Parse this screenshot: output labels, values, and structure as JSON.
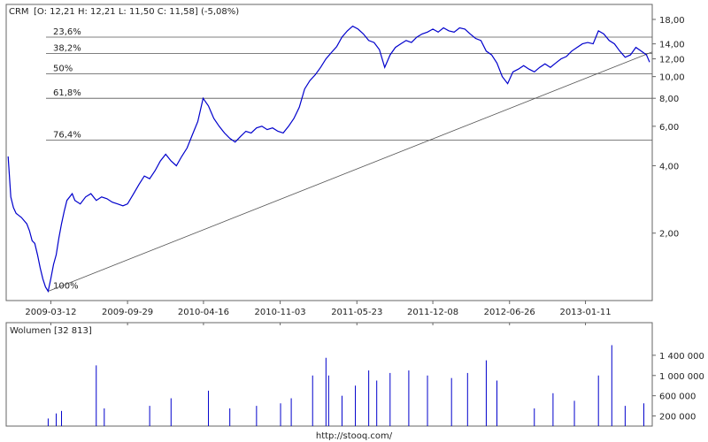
{
  "header": {
    "ticker": "CRM",
    "ohlc": "[O: 12,21  H: 12,21  L: 11,50  C: 11,58] (-5,08%)"
  },
  "volume_panel": {
    "title": "Wolumen [32 813]"
  },
  "footer": {
    "url": "http://stooq.com/"
  },
  "colors": {
    "price_line": "#0000cc",
    "volume_bars": "#0000cc",
    "fib_lines": "#555555",
    "trend_line": "#555555",
    "frame": "#666666",
    "tick_grid": "#cccccc"
  },
  "chart_data": [
    {
      "type": "line",
      "title": "",
      "scale": "log",
      "ylim": [
        1.0,
        21.0
      ],
      "price_ticks": [
        "18,00",
        "14,00",
        "12,00",
        "10,00",
        "8,00",
        "6,00",
        "4,00",
        "2,00"
      ],
      "x_tick_labels": [
        "2009-03-12",
        "2009-09-29",
        "2010-04-16",
        "2010-11-03",
        "2011-05-23",
        "2011-12-08",
        "2012-06-26",
        "2013-01-11"
      ],
      "fib_levels": [
        {
          "label": "23,6%",
          "price": 15.0
        },
        {
          "label": "38,2%",
          "price": 12.7
        },
        {
          "label": "50%",
          "price": 10.3
        },
        {
          "label": "61,8%",
          "price": 8.0
        },
        {
          "label": "76,4%",
          "price": 5.2
        },
        {
          "label": "100%",
          "price": 1.1
        }
      ],
      "trend_line": {
        "from": [
          "2009-03-05",
          1.1
        ],
        "to": [
          "2013-06-28",
          12.2
        ]
      },
      "series": [
        {
          "name": "",
          "points": [
            [
              "2008-11-20",
              4.4
            ],
            [
              "2008-11-27",
              2.9
            ],
            [
              "2008-12-04",
              2.6
            ],
            [
              "2008-12-11",
              2.45
            ],
            [
              "2008-12-18",
              2.4
            ],
            [
              "2008-12-25",
              2.35
            ],
            [
              "2009-01-08",
              2.2
            ],
            [
              "2009-01-15",
              2.05
            ],
            [
              "2009-01-22",
              1.85
            ],
            [
              "2009-01-29",
              1.8
            ],
            [
              "2009-02-05",
              1.6
            ],
            [
              "2009-02-12",
              1.4
            ],
            [
              "2009-02-19",
              1.25
            ],
            [
              "2009-02-26",
              1.15
            ],
            [
              "2009-03-05",
              1.1
            ],
            [
              "2009-03-12",
              1.25
            ],
            [
              "2009-03-19",
              1.45
            ],
            [
              "2009-03-26",
              1.6
            ],
            [
              "2009-04-02",
              1.9
            ],
            [
              "2009-04-09",
              2.2
            ],
            [
              "2009-04-16",
              2.5
            ],
            [
              "2009-04-23",
              2.8
            ],
            [
              "2009-05-07",
              3.0
            ],
            [
              "2009-05-14",
              2.8
            ],
            [
              "2009-05-28",
              2.7
            ],
            [
              "2009-06-11",
              2.9
            ],
            [
              "2009-06-25",
              3.0
            ],
            [
              "2009-07-09",
              2.8
            ],
            [
              "2009-07-23",
              2.9
            ],
            [
              "2009-08-06",
              2.85
            ],
            [
              "2009-08-20",
              2.75
            ],
            [
              "2009-09-03",
              2.7
            ],
            [
              "2009-09-17",
              2.65
            ],
            [
              "2009-09-29",
              2.7
            ],
            [
              "2009-10-15",
              3.0
            ],
            [
              "2009-10-29",
              3.3
            ],
            [
              "2009-11-12",
              3.6
            ],
            [
              "2009-11-26",
              3.5
            ],
            [
              "2009-12-10",
              3.8
            ],
            [
              "2009-12-24",
              4.2
            ],
            [
              "2010-01-07",
              4.5
            ],
            [
              "2010-01-21",
              4.2
            ],
            [
              "2010-02-04",
              4.0
            ],
            [
              "2010-02-18",
              4.4
            ],
            [
              "2010-03-04",
              4.8
            ],
            [
              "2010-03-18",
              5.5
            ],
            [
              "2010-04-01",
              6.3
            ],
            [
              "2010-04-15",
              8.0
            ],
            [
              "2010-04-29",
              7.4
            ],
            [
              "2010-05-13",
              6.5
            ],
            [
              "2010-05-27",
              6.0
            ],
            [
              "2010-06-10",
              5.6
            ],
            [
              "2010-06-24",
              5.3
            ],
            [
              "2010-07-08",
              5.1
            ],
            [
              "2010-07-22",
              5.4
            ],
            [
              "2010-08-05",
              5.7
            ],
            [
              "2010-08-19",
              5.6
            ],
            [
              "2010-09-02",
              5.9
            ],
            [
              "2010-09-16",
              6.0
            ],
            [
              "2010-09-30",
              5.8
            ],
            [
              "2010-10-14",
              5.9
            ],
            [
              "2010-10-28",
              5.7
            ],
            [
              "2010-11-11",
              5.6
            ],
            [
              "2010-11-25",
              6.0
            ],
            [
              "2010-12-09",
              6.5
            ],
            [
              "2010-12-23",
              7.3
            ],
            [
              "2011-01-06",
              8.8
            ],
            [
              "2011-01-20",
              9.6
            ],
            [
              "2011-02-03",
              10.2
            ],
            [
              "2011-02-17",
              11.0
            ],
            [
              "2011-03-03",
              12.0
            ],
            [
              "2011-03-17",
              12.8
            ],
            [
              "2011-03-31",
              13.6
            ],
            [
              "2011-04-14",
              15.0
            ],
            [
              "2011-04-28",
              16.0
            ],
            [
              "2011-05-12",
              16.8
            ],
            [
              "2011-05-26",
              16.3
            ],
            [
              "2011-06-09",
              15.5
            ],
            [
              "2011-06-23",
              14.5
            ],
            [
              "2011-07-07",
              14.2
            ],
            [
              "2011-07-21",
              13.2
            ],
            [
              "2011-08-04",
              11.0
            ],
            [
              "2011-08-18",
              12.5
            ],
            [
              "2011-09-01",
              13.5
            ],
            [
              "2011-09-15",
              14.0
            ],
            [
              "2011-09-29",
              14.5
            ],
            [
              "2011-10-13",
              14.2
            ],
            [
              "2011-10-27",
              15.0
            ],
            [
              "2011-11-10",
              15.5
            ],
            [
              "2011-11-24",
              15.8
            ],
            [
              "2011-12-08",
              16.3
            ],
            [
              "2011-12-22",
              15.8
            ],
            [
              "2012-01-05",
              16.5
            ],
            [
              "2012-01-19",
              16.0
            ],
            [
              "2012-02-02",
              15.8
            ],
            [
              "2012-02-16",
              16.5
            ],
            [
              "2012-03-01",
              16.3
            ],
            [
              "2012-03-15",
              15.5
            ],
            [
              "2012-03-29",
              14.8
            ],
            [
              "2012-04-12",
              14.5
            ],
            [
              "2012-04-26",
              13.0
            ],
            [
              "2012-05-10",
              12.5
            ],
            [
              "2012-05-24",
              11.5
            ],
            [
              "2012-06-07",
              10.0
            ],
            [
              "2012-06-21",
              9.3
            ],
            [
              "2012-07-05",
              10.5
            ],
            [
              "2012-07-19",
              10.8
            ],
            [
              "2012-08-02",
              11.2
            ],
            [
              "2012-08-16",
              10.8
            ],
            [
              "2012-08-30",
              10.5
            ],
            [
              "2012-09-13",
              11.0
            ],
            [
              "2012-09-27",
              11.4
            ],
            [
              "2012-10-11",
              11.0
            ],
            [
              "2012-10-25",
              11.5
            ],
            [
              "2012-11-08",
              12.0
            ],
            [
              "2012-11-22",
              12.3
            ],
            [
              "2012-12-06",
              13.0
            ],
            [
              "2012-12-20",
              13.5
            ],
            [
              "2013-01-03",
              14.0
            ],
            [
              "2013-01-17",
              14.2
            ],
            [
              "2013-01-31",
              14.0
            ],
            [
              "2013-02-14",
              16.0
            ],
            [
              "2013-02-28",
              15.5
            ],
            [
              "2013-03-14",
              14.5
            ],
            [
              "2013-03-28",
              14.0
            ],
            [
              "2013-04-11",
              13.0
            ],
            [
              "2013-04-25",
              12.2
            ],
            [
              "2013-05-09",
              12.5
            ],
            [
              "2013-05-23",
              13.5
            ],
            [
              "2013-06-06",
              13.0
            ],
            [
              "2013-06-20",
              12.5
            ],
            [
              "2013-06-28",
              11.6
            ]
          ]
        }
      ]
    },
    {
      "type": "bar",
      "title": "Wolumen [32 813]",
      "ylim": [
        0,
        1800000
      ],
      "y_tick_labels": [
        "1 400 000",
        "1 000 000",
        "600 000",
        "200 000"
      ],
      "y_ticks": [
        1400000,
        1000000,
        600000,
        200000
      ],
      "series": [
        {
          "name": "",
          "points": [
            [
              "2009-03-05",
              150000
            ],
            [
              "2009-03-26",
              250000
            ],
            [
              "2009-04-09",
              300000
            ],
            [
              "2009-07-09",
              1200000
            ],
            [
              "2009-07-30",
              350000
            ],
            [
              "2009-11-26",
              400000
            ],
            [
              "2010-01-21",
              550000
            ],
            [
              "2010-04-29",
              700000
            ],
            [
              "2010-06-24",
              350000
            ],
            [
              "2010-09-02",
              400000
            ],
            [
              "2010-11-04",
              450000
            ],
            [
              "2010-12-02",
              550000
            ],
            [
              "2011-01-27",
              1000000
            ],
            [
              "2011-03-03",
              1350000
            ],
            [
              "2011-03-10",
              1000000
            ],
            [
              "2011-04-14",
              600000
            ],
            [
              "2011-05-19",
              800000
            ],
            [
              "2011-06-23",
              1100000
            ],
            [
              "2011-07-14",
              900000
            ],
            [
              "2011-08-18",
              1050000
            ],
            [
              "2011-10-06",
              1100000
            ],
            [
              "2011-11-24",
              1000000
            ],
            [
              "2012-01-26",
              950000
            ],
            [
              "2012-03-08",
              1050000
            ],
            [
              "2012-04-26",
              1300000
            ],
            [
              "2012-05-24",
              900000
            ],
            [
              "2012-08-30",
              350000
            ],
            [
              "2012-10-18",
              650000
            ],
            [
              "2012-12-13",
              500000
            ],
            [
              "2013-02-14",
              1000000
            ],
            [
              "2013-03-21",
              1600000
            ],
            [
              "2013-04-25",
              400000
            ],
            [
              "2013-06-13",
              450000
            ]
          ]
        }
      ]
    }
  ]
}
